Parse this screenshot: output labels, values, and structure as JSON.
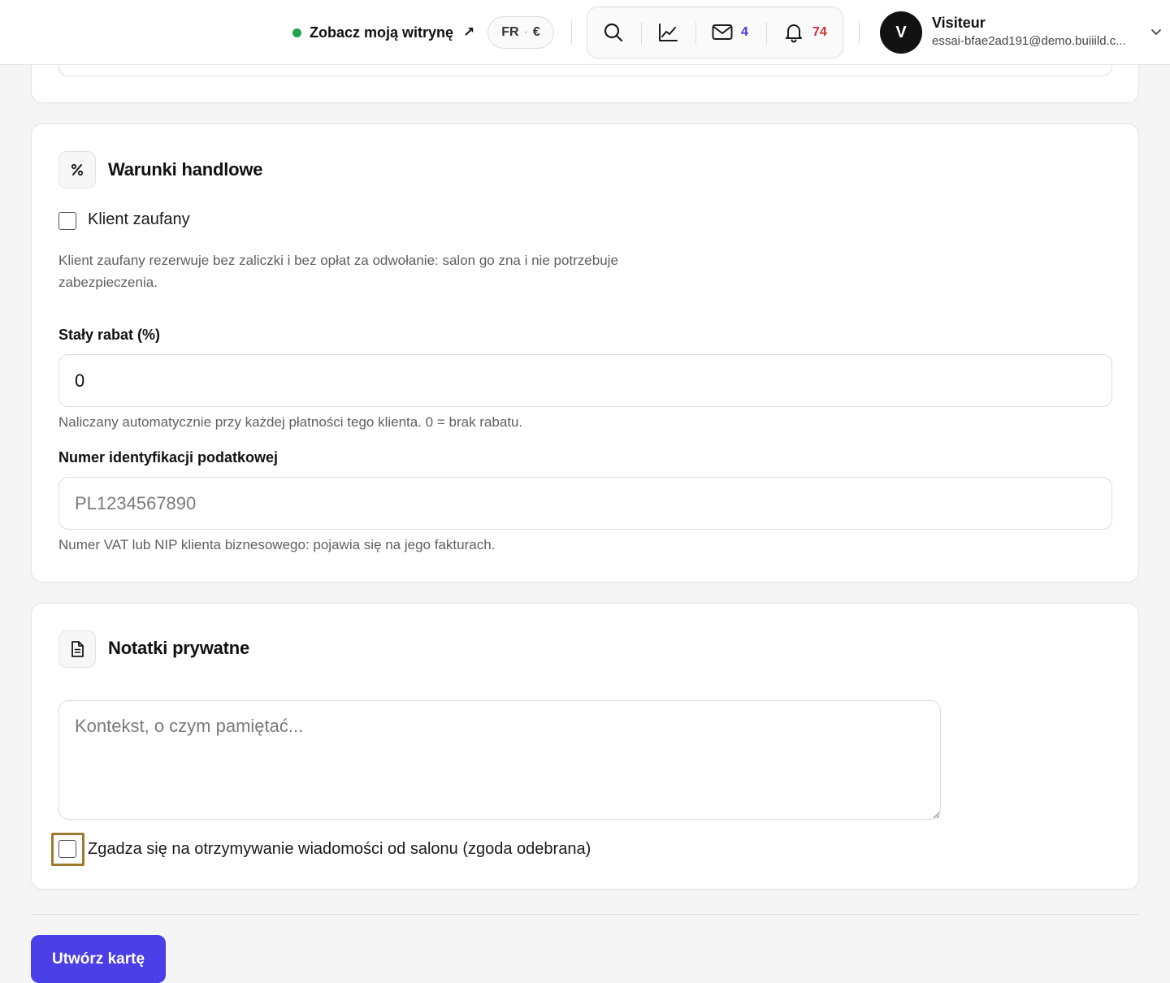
{
  "header": {
    "site_link_label": "Zobacz moją witrynę",
    "site_link_arrow": "↗",
    "lang_code": "FR",
    "lang_separator": "·",
    "currency_symbol": "€",
    "messages_count": "4",
    "notifications_count": "74",
    "user": {
      "initial": "V",
      "name": "Visiteur",
      "email": "essai-bfae2ad191@demo.buiiild.c..."
    }
  },
  "terms_section": {
    "title": "Warunki handlowe",
    "trusted_client_label": "Klient zaufany",
    "trusted_client_help": "Klient zaufany rezerwuje bez zaliczki i bez opłat za odwołanie: salon go zna i nie potrzebuje zabezpieczenia.",
    "discount_label": "Stały rabat (%)",
    "discount_value": "0",
    "discount_help": "Naliczany automatycznie przy każdej płatności tego klienta. 0 = brak rabatu.",
    "tax_id_label": "Numer identyfikacji podatkowej",
    "tax_id_placeholder": "PL1234567890",
    "tax_id_help": "Numer VAT lub NIP klienta biznesowego: pojawia się na jego fakturach."
  },
  "notes_section": {
    "title": "Notatki prywatne",
    "notes_placeholder": "Kontekst, o czym pamiętać...",
    "consent_label": "Zgadza się na otrzymywanie wiadomości od salonu (zgoda odebrana)"
  },
  "actions": {
    "create_label": "Utwórz kartę"
  },
  "colors": {
    "accent": "#4a3ee6",
    "online_dot": "#22a34a",
    "messages_count": "#3b3bd6",
    "notifications_count": "#d62c2c",
    "focus_ring": "#9c7b2f"
  }
}
